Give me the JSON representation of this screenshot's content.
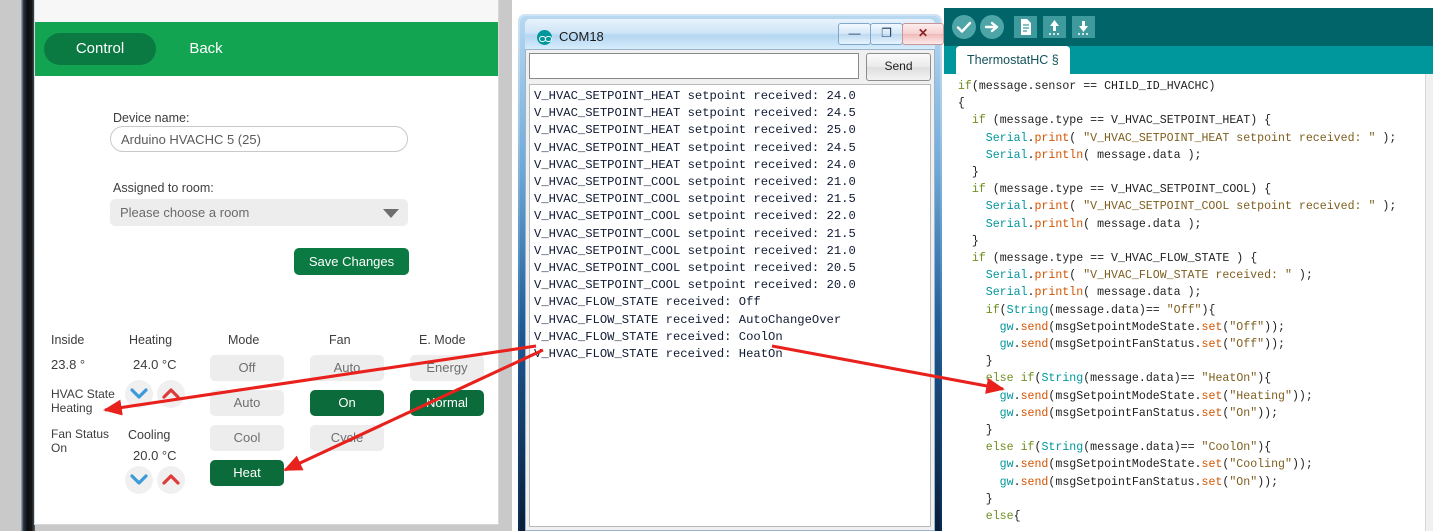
{
  "left_app": {
    "tabs": [
      {
        "label": "Control",
        "active": true
      },
      {
        "label": "Back",
        "active": false
      }
    ],
    "device_name_label": "Device name:",
    "device_name_value": "Arduino HVACHC 5 (25)",
    "room_label": "Assigned to room:",
    "room_value": "Please choose a room",
    "save_button": "Save Changes",
    "columns": [
      "Inside",
      "Heating",
      "Mode",
      "Fan",
      "E. Mode"
    ],
    "inside_value": "23.8 °",
    "hvac_state_label": "HVAC State",
    "hvac_state_value": "Heating",
    "fan_status_label": "Fan Status",
    "fan_status_value": "On",
    "heating_label": "Heating",
    "heating_value": "24.0 °C",
    "cooling_label": "Cooling",
    "cooling_value": "20.0 °C",
    "mode_buttons": [
      {
        "label": "Off",
        "active": false
      },
      {
        "label": "Auto",
        "active": false
      },
      {
        "label": "Cool",
        "active": false
      },
      {
        "label": "Heat",
        "active": true
      }
    ],
    "fan_buttons": [
      {
        "label": "Auto",
        "active": false
      },
      {
        "label": "On",
        "active": true
      },
      {
        "label": "Cycle",
        "active": false
      }
    ],
    "emode_buttons": [
      {
        "label": "Energy",
        "active": false
      },
      {
        "label": "Normal",
        "active": true
      }
    ],
    "colors": {
      "header_green": "#13a452",
      "active_green": "#0b6b3a",
      "chevron_down": "#3d9ad8",
      "chevron_up": "#e03b3b"
    }
  },
  "serial_monitor": {
    "title": "COM18",
    "input_value": "",
    "send_button": "Send",
    "window_buttons": {
      "minimize": "—",
      "maximize": "❐",
      "close": "✕"
    },
    "log_lines": [
      "V_HVAC_SETPOINT_HEAT setpoint received: 24.0",
      "V_HVAC_SETPOINT_HEAT setpoint received: 24.5",
      "V_HVAC_SETPOINT_HEAT setpoint received: 25.0",
      "V_HVAC_SETPOINT_HEAT setpoint received: 24.5",
      "V_HVAC_SETPOINT_HEAT setpoint received: 24.0",
      "V_HVAC_SETPOINT_COOL setpoint received: 21.0",
      "V_HVAC_SETPOINT_COOL setpoint received: 21.5",
      "V_HVAC_SETPOINT_COOL setpoint received: 22.0",
      "V_HVAC_SETPOINT_COOL setpoint received: 21.5",
      "V_HVAC_SETPOINT_COOL setpoint received: 21.0",
      "V_HVAC_SETPOINT_COOL setpoint received: 20.5",
      "V_HVAC_SETPOINT_COOL setpoint received: 20.0",
      "V_HVAC_FLOW_STATE received: Off",
      "V_HVAC_FLOW_STATE received: AutoChangeOver",
      "V_HVAC_FLOW_STATE received: CoolOn",
      "V_HVAC_FLOW_STATE received: HeatOn"
    ]
  },
  "ide": {
    "toolbar_icons": [
      "verify-check-icon",
      "upload-arrow-icon",
      "new-file-icon",
      "open-file-icon",
      "save-file-icon"
    ],
    "tab_label": "ThermostatHC §",
    "colors": {
      "toolbar": "#006468",
      "tabbar": "#00979c"
    },
    "code_lines": [
      "  if(message.sensor == CHILD_ID_HVACHC)",
      "  {",
      "    if (message.type == V_HVAC_SETPOINT_HEAT) {",
      "      Serial.print( \"V_HVAC_SETPOINT_HEAT setpoint received: \" );",
      "      Serial.println( message.data );",
      "    }",
      "    if (message.type == V_HVAC_SETPOINT_COOL) {",
      "      Serial.print( \"V_HVAC_SETPOINT_COOL setpoint received: \" );",
      "      Serial.println( message.data );",
      "    }",
      "    if (message.type == V_HVAC_FLOW_STATE ) {",
      "      Serial.print( \"V_HVAC_FLOW_STATE received: \" );",
      "      Serial.println( message.data );",
      "      if(String(message.data)== \"Off\"){",
      "        gw.send(msgSetpointModeState.set(\"Off\"));",
      "        gw.send(msgSetpointFanStatus.set(\"Off\"));",
      "      }",
      "      else if(String(message.data)== \"HeatOn\"){",
      "        gw.send(msgSetpointModeState.set(\"Heating\"));",
      "        gw.send(msgSetpointFanStatus.set(\"On\"));",
      "      }",
      "      else if(String(message.data)== \"CoolOn\"){",
      "        gw.send(msgSetpointModeState.set(\"Cooling\"));",
      "        gw.send(msgSetpointFanStatus.set(\"On\"));",
      "      }",
      "      else{"
    ]
  },
  "annotations": {
    "arrow_color": "#e8211c",
    "arrows": [
      {
        "name": "hvac-state-to-serial",
        "from": "serial-log-heaton-line",
        "to": "hvac-state-heating-label"
      },
      {
        "name": "heat-button-to-serial",
        "from": "serial-log-heaton-line",
        "to": "mode-heat-button"
      },
      {
        "name": "serial-heaton-to-code",
        "from": "serial-log-heaton-line",
        "to": "code-heaton-branch"
      }
    ]
  }
}
